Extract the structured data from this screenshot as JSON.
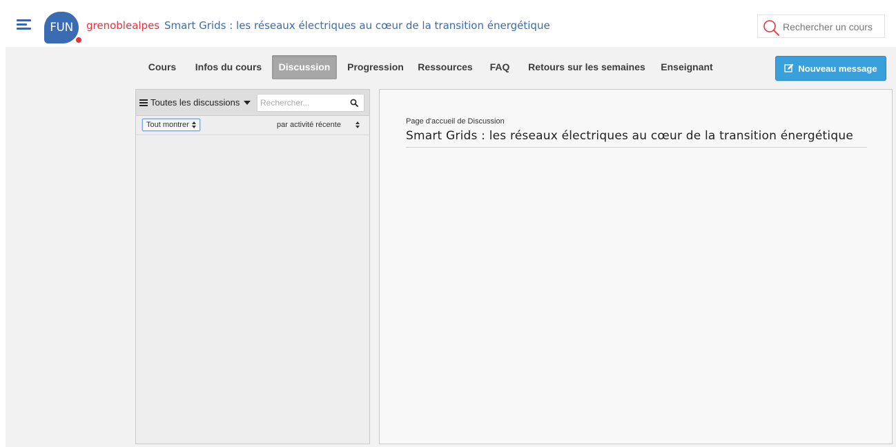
{
  "header": {
    "logo_text": "FUN",
    "org": "grenoblealpes",
    "course_title": "Smart Grids : les réseaux électriques au cœur de la transition énergétique",
    "search_placeholder": "Rechercher un cours",
    "colors": {
      "brand_blue": "#3a6cb4",
      "brand_red": "#e8323c"
    }
  },
  "tabs": [
    {
      "label": "Cours",
      "active": false
    },
    {
      "label": "Infos du cours",
      "active": false
    },
    {
      "label": "Discussion",
      "active": true
    },
    {
      "label": "Progression",
      "active": false
    },
    {
      "label": "Ressources",
      "active": false
    },
    {
      "label": "FAQ",
      "active": false
    },
    {
      "label": "Retours sur les semaines",
      "active": false
    },
    {
      "label": "Enseignant",
      "active": false
    }
  ],
  "new_message": {
    "label": "Nouveau message",
    "icon": "edit-icon",
    "color": "#3aa0dc"
  },
  "sidebar": {
    "menu_label": "Toutes les discussions",
    "search_placeholder": "Rechercher...",
    "filter_label": "Tout montrer",
    "sort_label": "par activité récente"
  },
  "content": {
    "breadcrumb": "Page d'accueil de Discussion",
    "title": "Smart Grids : les réseaux électriques au cœur de la transition énergétique"
  }
}
